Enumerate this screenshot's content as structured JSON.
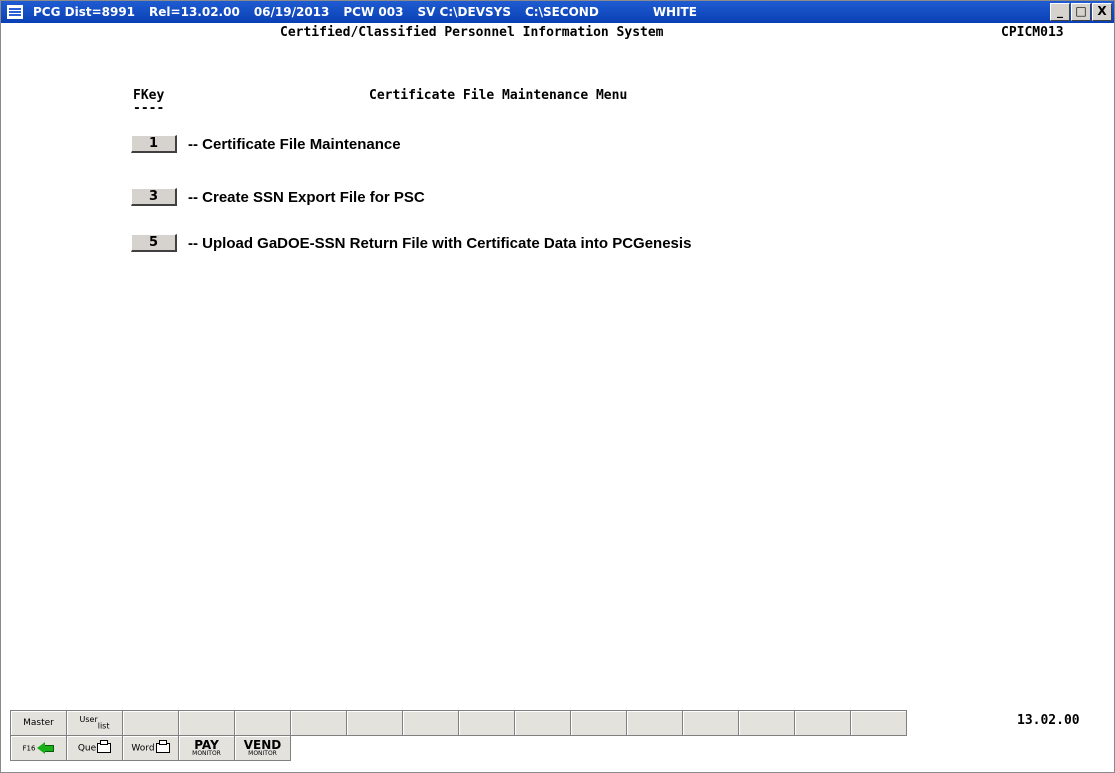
{
  "window": {
    "title_segments": [
      "PCG Dist=8991",
      "Rel=13.02.00",
      "06/19/2013",
      "PCW 003",
      "SV C:\\DEVSYS",
      "C:\\SECOND",
      "WHITE"
    ],
    "controls": [
      "_",
      "□",
      "X"
    ]
  },
  "header": {
    "system_title": "Certified/Classified Personnel Information System",
    "program_id": "CPICM013"
  },
  "menu": {
    "fkey_header": "FKey",
    "fkey_underline": "----",
    "title": "Certificate File Maintenance Menu",
    "items": [
      {
        "key": "1",
        "label": "-- Certificate File Maintenance"
      },
      {
        "key": "3",
        "label": "-- Create SSN Export File for PSC"
      },
      {
        "key": "5",
        "label": "-- Upload GaDOE-SSN Return File with Certificate Data into PCGenesis"
      }
    ]
  },
  "footer": {
    "version": "13.02.00",
    "toolbar": {
      "master": "Master",
      "user": "User",
      "list": "list",
      "f16": "F16",
      "que": "Que",
      "word": "Word",
      "pay": "PAY",
      "pay_sub": "MONITOR",
      "vend": "VEND",
      "vend_sub": "MONITOR"
    }
  }
}
